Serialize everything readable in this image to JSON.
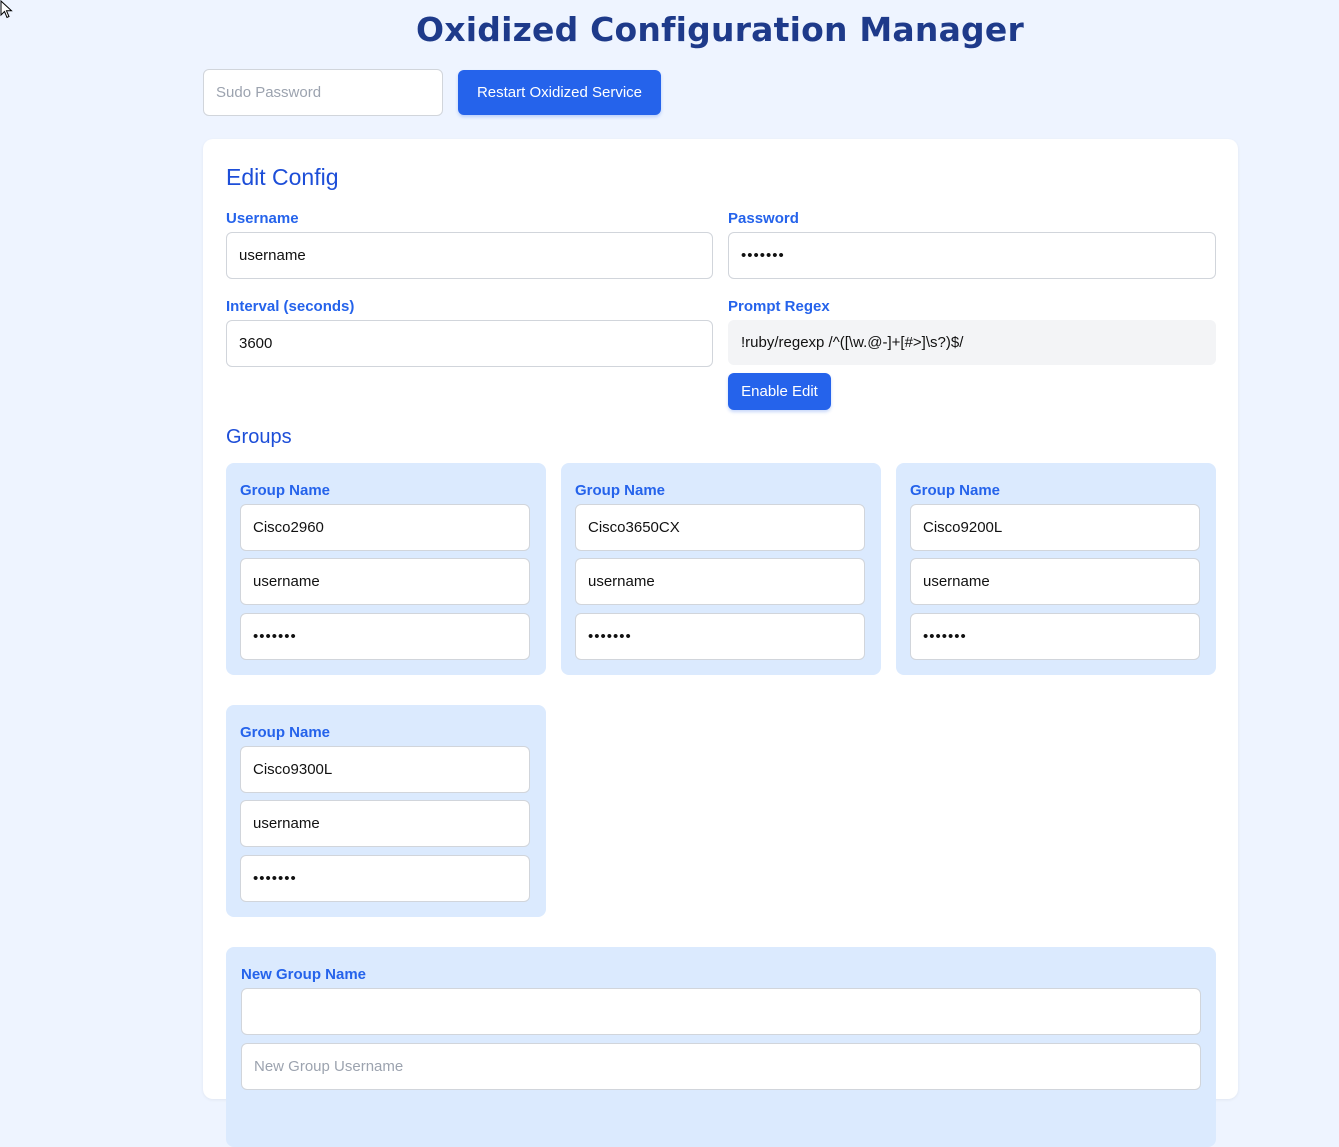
{
  "header": {
    "title": "Oxidized Configuration Manager"
  },
  "topbar": {
    "sudo_placeholder": "Sudo Password",
    "restart_label": "Restart Oxidized Service"
  },
  "config": {
    "heading": "Edit Config",
    "username_label": "Username",
    "username_value": "username",
    "password_label": "Password",
    "password_value": "1234567",
    "interval_label": "Interval (seconds)",
    "interval_value": "3600",
    "prompt_label": "Prompt Regex",
    "prompt_value": "!ruby/regexp /^([\\w.@-]+[#>]\\s?)$/",
    "enable_edit_label": "Enable Edit"
  },
  "groups": {
    "heading": "Groups",
    "name_label": "Group Name",
    "items": [
      {
        "name": "Cisco2960",
        "username": "username",
        "password": "1234567"
      },
      {
        "name": "Cisco3650CX",
        "username": "username",
        "password": "1234567"
      },
      {
        "name": "Cisco9200L",
        "username": "username",
        "password": "1234567"
      },
      {
        "name": "Cisco9300L",
        "username": "username",
        "password": "1234567"
      }
    ]
  },
  "new_group": {
    "name_label": "New Group Name",
    "name_value": "",
    "username_placeholder": "New Group Username"
  }
}
